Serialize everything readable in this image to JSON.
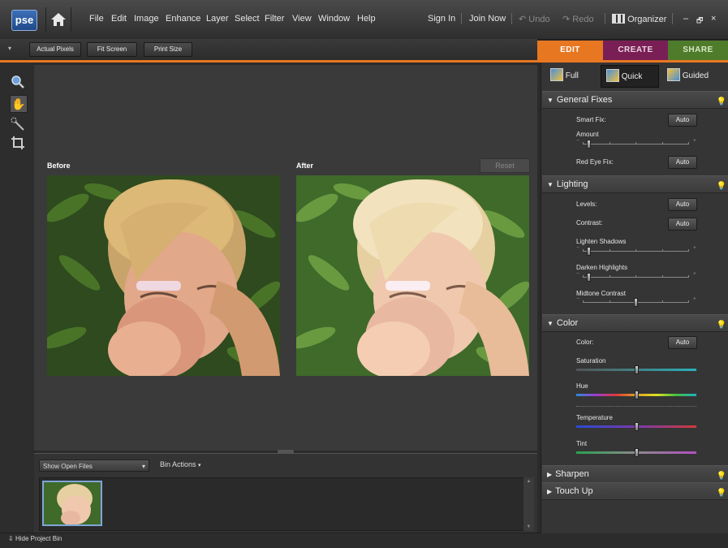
{
  "app": {
    "logo": "pse"
  },
  "menu": [
    "File",
    "Edit",
    "Image",
    "Enhance",
    "Layer",
    "Select",
    "Filter",
    "View",
    "Window",
    "Help"
  ],
  "account": {
    "sign_in": "Sign In",
    "join_now": "Join Now"
  },
  "history": {
    "undo": "Undo",
    "redo": "Redo"
  },
  "organizer": "Organizer",
  "window_controls": {
    "minimize": "–",
    "restore": "🗗",
    "close": "×"
  },
  "options_bar": {
    "actual_pixels": "Actual Pixels",
    "fit_screen": "Fit Screen",
    "print_size": "Print Size"
  },
  "tabs": [
    {
      "label": "EDIT",
      "color": "#e87722",
      "active": true
    },
    {
      "label": "CREATE",
      "color": "#7a1f55",
      "active": false
    },
    {
      "label": "SHARE",
      "color": "#4f7c2a",
      "active": false
    }
  ],
  "modes": [
    {
      "label": "Full",
      "active": false
    },
    {
      "label": "Quick",
      "active": true
    },
    {
      "label": "Guided",
      "active": false
    }
  ],
  "tools": [
    "zoom-icon",
    "hand-icon",
    "quick-selection-icon",
    "crop-icon"
  ],
  "canvas": {
    "before_label": "Before",
    "after_label": "After",
    "reset_label": "Reset"
  },
  "panel": {
    "general_fixes": {
      "title": "General Fixes",
      "smart_fix_label": "Smart Fix:",
      "smart_fix_auto": "Auto",
      "amount_label": "Amount",
      "amount_value": 0.05,
      "red_eye_label": "Red Eye Fix:",
      "red_eye_auto": "Auto"
    },
    "lighting": {
      "title": "Lighting",
      "levels_label": "Levels:",
      "levels_auto": "Auto",
      "contrast_label": "Contrast:",
      "contrast_auto": "Auto",
      "lighten_label": "Lighten Shadows",
      "lighten_value": 0.05,
      "darken_label": "Darken Highlights",
      "darken_value": 0.05,
      "midtone_label": "Midtone Contrast",
      "midtone_value": 0.5
    },
    "color": {
      "title": "Color",
      "color_label": "Color:",
      "color_auto": "Auto",
      "saturation_label": "Saturation",
      "saturation_value": 0.5,
      "hue_label": "Hue",
      "hue_value": 0.5,
      "temperature_label": "Temperature",
      "temperature_value": 0.5,
      "tint_label": "Tint",
      "tint_value": 0.5
    },
    "sharpen": {
      "title": "Sharpen"
    },
    "touch_up": {
      "title": "Touch Up"
    }
  },
  "bin": {
    "show_label": "Show Open Files",
    "actions_label": "Bin Actions"
  },
  "status": {
    "hide_bin": "Hide Project Bin"
  },
  "colors": {
    "accent": "#e87722",
    "panel_bg": "#353535",
    "canvas_bg": "#3a3a3a"
  }
}
